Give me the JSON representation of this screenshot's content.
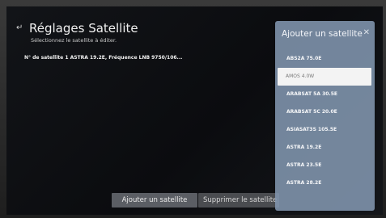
{
  "header": {
    "back_icon": "↵",
    "title": "Réglages Satellite",
    "subtitle": "Sélectionnez le satellite à éditer."
  },
  "satellite_info": "N° de satellite 1 ASTRA 19.2E, Fréquence LNB 9750/106...",
  "buttons": {
    "add_label": "Ajouter un satellite",
    "delete_label": "Supprimer le satellite"
  },
  "panel": {
    "title": "Ajouter un satellite",
    "close_icon": "✕",
    "selected_index": 1,
    "items": [
      {
        "label": "ABS2A 75.0E"
      },
      {
        "label": "AMOS 4.0W"
      },
      {
        "label": "ARABSAT 5A 30.5E"
      },
      {
        "label": "ARABSAT 5C 20.0E"
      },
      {
        "label": "ASIASAT3S 105.5E"
      },
      {
        "label": "ASTRA 19.2E"
      },
      {
        "label": "ASTRA 23.5E"
      },
      {
        "label": "ASTRA 28.2E"
      }
    ]
  }
}
